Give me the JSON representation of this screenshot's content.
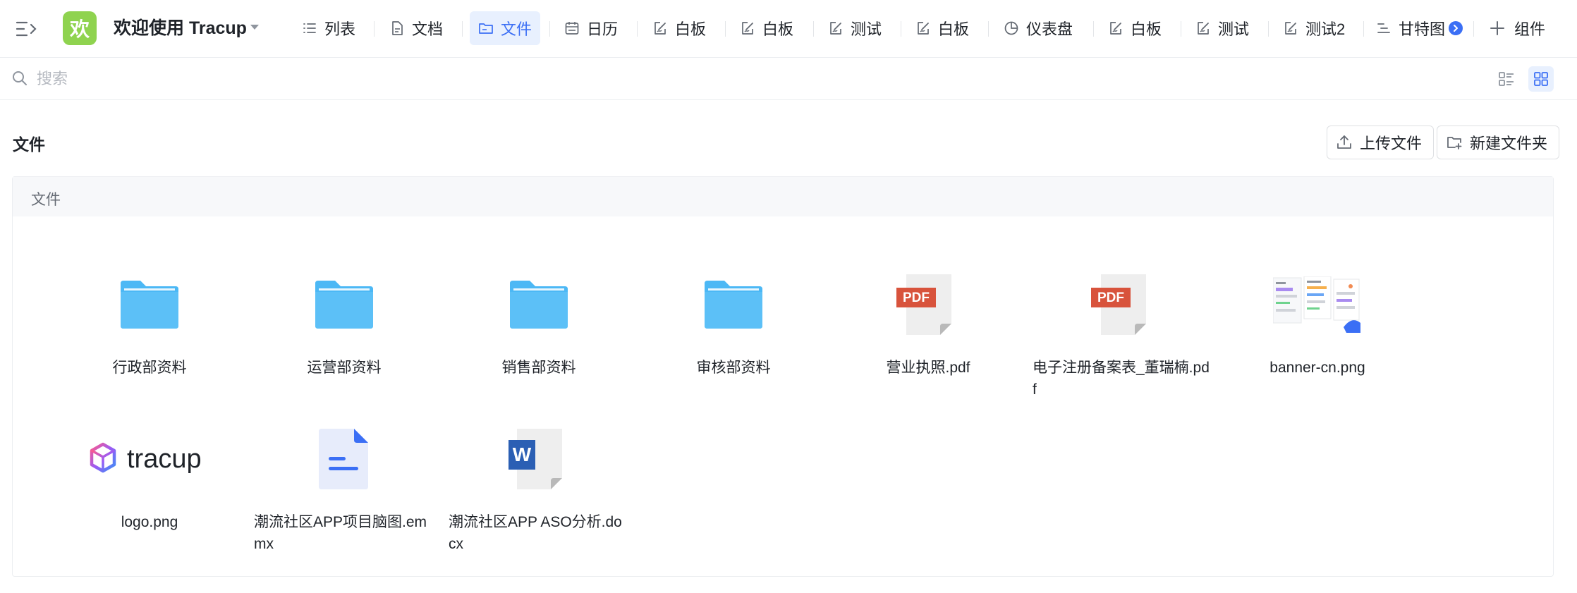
{
  "app": {
    "logo_char": "欢",
    "title": "欢迎使用 Tracup"
  },
  "tabs": [
    {
      "label": "列表",
      "icon": "list-icon"
    },
    {
      "label": "文档",
      "icon": "document-icon"
    },
    {
      "label": "文件",
      "icon": "folder-icon",
      "active": true
    },
    {
      "label": "日历",
      "icon": "calendar-icon"
    },
    {
      "label": "白板",
      "icon": "whiteboard-icon"
    },
    {
      "label": "白板",
      "icon": "whiteboard-icon"
    },
    {
      "label": "测试",
      "icon": "whiteboard-icon"
    },
    {
      "label": "白板",
      "icon": "whiteboard-icon"
    },
    {
      "label": "仪表盘",
      "icon": "dashboard-icon"
    },
    {
      "label": "白板",
      "icon": "whiteboard-icon"
    },
    {
      "label": "测试",
      "icon": "whiteboard-icon"
    },
    {
      "label": "测试2",
      "icon": "whiteboard-icon"
    },
    {
      "label": "甘特图",
      "icon": "gantt-icon"
    }
  ],
  "add_component_label": "组件",
  "search": {
    "placeholder": "搜索"
  },
  "section_title": "文件",
  "upload_label": "上传文件",
  "new_folder_label": "新建文件夹",
  "panel_label": "文件",
  "files": [
    {
      "name": "行政部资料",
      "type": "folder"
    },
    {
      "name": "运营部资料",
      "type": "folder"
    },
    {
      "name": "销售部资料",
      "type": "folder"
    },
    {
      "name": "审核部资料",
      "type": "folder"
    },
    {
      "name": "营业执照.pdf",
      "type": "pdf",
      "badge": "PDF"
    },
    {
      "name": "电子注册备案表_董瑞楠.pdf",
      "type": "pdf",
      "badge": "PDF"
    },
    {
      "name": "banner-cn.png",
      "type": "image"
    },
    {
      "name": "logo.png",
      "type": "image",
      "logo_text": "tracup"
    },
    {
      "name": "潮流社区APP项目脑图.emmx",
      "type": "mindmap"
    },
    {
      "name": "潮流社区APP ASO分析.docx",
      "type": "word",
      "badge": "W"
    }
  ],
  "colors": {
    "accent": "#3b6ff5",
    "folder": "#4cb8f5",
    "pdf_badge": "#d8533c",
    "word_badge": "#2b5fb4",
    "logo_bg": "#8fd34f"
  }
}
